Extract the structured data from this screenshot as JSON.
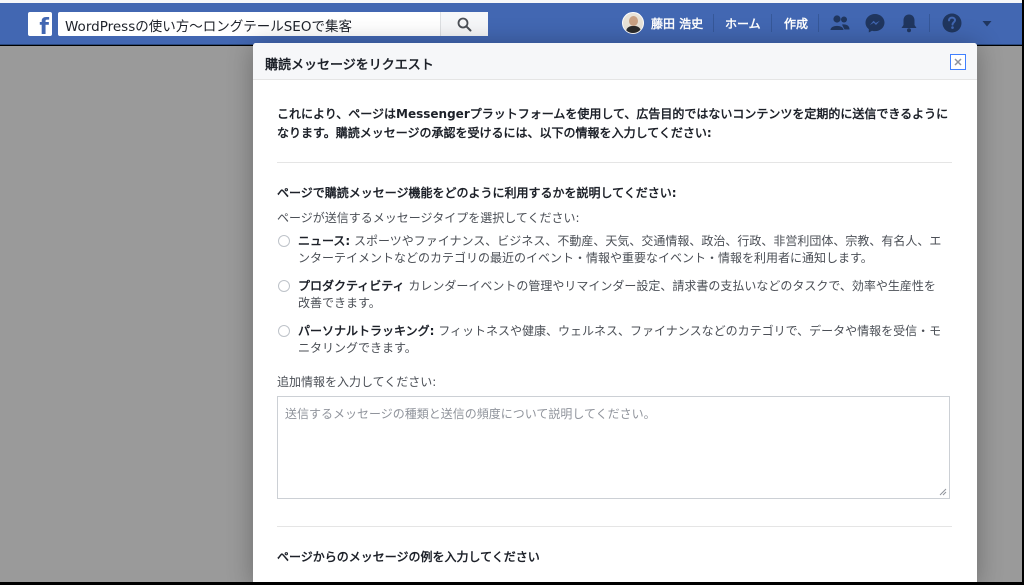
{
  "header": {
    "search_value": "WordPressの使い方〜ロングテールSEOで集客",
    "profile_name": "藤田 浩史",
    "nav_home": "ホーム",
    "nav_create": "作成"
  },
  "dialog": {
    "title": "購読メッセージをリクエスト",
    "intro": "これにより、ページはMessengerプラットフォームを使用して、広告目的ではないコンテンツを定期的に送信できるようになります。購読メッセージの承認を受けるには、以下の情報を入力してください:",
    "usage_question": "ページで購読メッセージ機能をどのように利用するかを説明してください:",
    "type_label": "ページが送信するメッセージタイプを選択してください:",
    "options": [
      {
        "label": "ニュース:",
        "description": "スポーツやファイナンス、ビジネス、不動産、天気、交通情報、政治、行政、非営利団体、宗教、有名人、エンターテイメントなどのカテゴリの最近のイベント・情報や重要なイベント・情報を利用者に通知します。"
      },
      {
        "label": "プロダクティビティ",
        "description": "カレンダーイベントの管理やリマインダー設定、請求書の支払いなどのタスクで、効率や生産性を改善できます。"
      },
      {
        "label": "パーソナルトラッキング:",
        "description": "フィットネスや健康、ウェルネス、ファイナンスなどのカテゴリで、データや情報を受信・モニタリングできます。"
      }
    ],
    "additional_label": "追加情報を入力してください:",
    "additional_placeholder": "送信するメッセージの種類と送信の頻度について説明してください。",
    "example_title": "ページからのメッセージの例を入力してください"
  },
  "colors": {
    "topbar": "#4267b2",
    "overlay": "#9a9a9a",
    "close_border": "#4080ff"
  }
}
